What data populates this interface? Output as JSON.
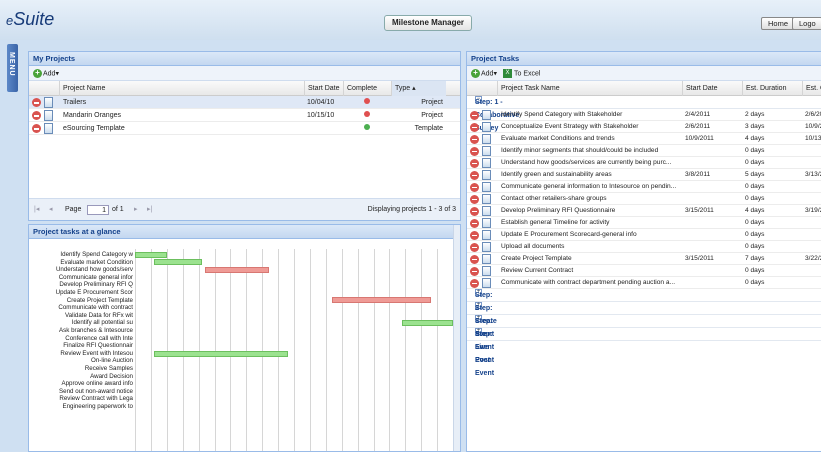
{
  "app": {
    "logo_prefix": "e",
    "logo_main": "Suite",
    "title": "Milestone Manager",
    "home": "Home",
    "logout": "Logo",
    "menu": "MENU"
  },
  "projects": {
    "title": "My Projects",
    "add": "Add",
    "columns": [
      "Project Name",
      "Start Date",
      "Complete",
      "Type ▴"
    ],
    "rows": [
      {
        "name": "Trailers",
        "start": "10/04/10",
        "status": "red",
        "type": "Project"
      },
      {
        "name": "Mandarin Oranges",
        "start": "10/15/10",
        "status": "red",
        "type": "Project"
      },
      {
        "name": "eSourcing Template",
        "start": "",
        "status": "green",
        "type": "Template"
      }
    ],
    "pager": {
      "page_label": "Page",
      "page": "1",
      "of": "of 1",
      "display": "Displaying projects 1 - 3 of 3"
    }
  },
  "glance": {
    "title": "Project tasks at a glance",
    "labels": [
      "Identify Spend Category w",
      "Evaluate market Condition",
      "Understand how goods/serv",
      "Communicate general infor",
      "Develop Preliminary RFI Q",
      "Update E Procurement Scor",
      "Create Project Template",
      "Communicate with contract",
      "Validate Data for RFx wit",
      "Identify all potential su",
      "Ask branches & Intesource",
      "Conference call with Inte",
      "Finalize RFI Questionnair",
      "Review Event with Intesou",
      "On-line Auction",
      "Receive Samples",
      "Award Decision",
      "Approve online award info",
      "Send out non-award notice",
      "Review Contract with Lega",
      "Engineering paperwork to"
    ],
    "bars": [
      {
        "row": 0,
        "start": 0.0,
        "len": 0.1,
        "color": "green"
      },
      {
        "row": 1,
        "start": 0.06,
        "len": 0.15,
        "color": "green"
      },
      {
        "row": 2,
        "start": 0.22,
        "len": 0.2,
        "color": "red"
      },
      {
        "row": 6,
        "start": 0.62,
        "len": 0.31,
        "color": "red"
      },
      {
        "row": 9,
        "start": 0.84,
        "len": 0.16,
        "color": "green"
      },
      {
        "row": 13,
        "start": 0.06,
        "len": 0.42,
        "color": "green"
      }
    ]
  },
  "tasks": {
    "title": "Project Tasks",
    "add": "Add",
    "excel": "To Excel",
    "columns": [
      "Project Task Name",
      "Start Date",
      "Est. Duration",
      "Est. C"
    ],
    "steps": [
      {
        "label": "Step: 1 - Collaborative Survey",
        "expanded": true
      },
      {
        "label": "Step: 2 - Create Event"
      },
      {
        "label": "Step: 3 - Pre Event"
      },
      {
        "label": "Step: 4 - Live Event"
      },
      {
        "label": "Step: 5 - Post Event"
      }
    ],
    "rows": [
      {
        "name": "Identify Spend Category with Stakeholder",
        "start": "2/4/2011",
        "dur": "2 days",
        "end": "2/6/20"
      },
      {
        "name": "Conceptualize Event Strategy with Stakeholder",
        "start": "2/6/2011",
        "dur": "3 days",
        "end": "10/9/2"
      },
      {
        "name": "Evaluate market Conditions and trends",
        "start": "10/9/2011",
        "dur": "4 days",
        "end": "10/13."
      },
      {
        "name": "Identify minor segments that should/could be included",
        "start": "",
        "dur": "0 days",
        "end": ""
      },
      {
        "name": "Understand how goods/services are currently being purc...",
        "start": "",
        "dur": "0 days",
        "end": ""
      },
      {
        "name": "Identify green and sustainability areas",
        "start": "3/8/2011",
        "dur": "5 days",
        "end": "3/13/2"
      },
      {
        "name": "Communicate general information to Intesource on pendin...",
        "start": "",
        "dur": "0 days",
        "end": ""
      },
      {
        "name": "Contact other retailers-share groups",
        "start": "",
        "dur": "0 days",
        "end": ""
      },
      {
        "name": "Develop Preliminary RFI Questionnaire",
        "start": "3/15/2011",
        "dur": "4 days",
        "end": "3/19/2"
      },
      {
        "name": "Establish general Timeline for activity",
        "start": "",
        "dur": "0 days",
        "end": ""
      },
      {
        "name": "Update E Procurement Scorecard-general info",
        "start": "",
        "dur": "0 days",
        "end": ""
      },
      {
        "name": "Upload all documents",
        "start": "",
        "dur": "0 days",
        "end": ""
      },
      {
        "name": "Create Project Template",
        "start": "3/15/2011",
        "dur": "7 days",
        "end": "3/22/2"
      },
      {
        "name": "Review Current Contract",
        "start": "",
        "dur": "0 days",
        "end": ""
      },
      {
        "name": "Communicate with contract department pending auction a...",
        "start": "",
        "dur": "0 days",
        "end": ""
      }
    ]
  },
  "colors": {
    "green": "#9be28f",
    "red": "#ef9b96",
    "dotRed": "#e05050",
    "dotGreen": "#4caf50"
  }
}
